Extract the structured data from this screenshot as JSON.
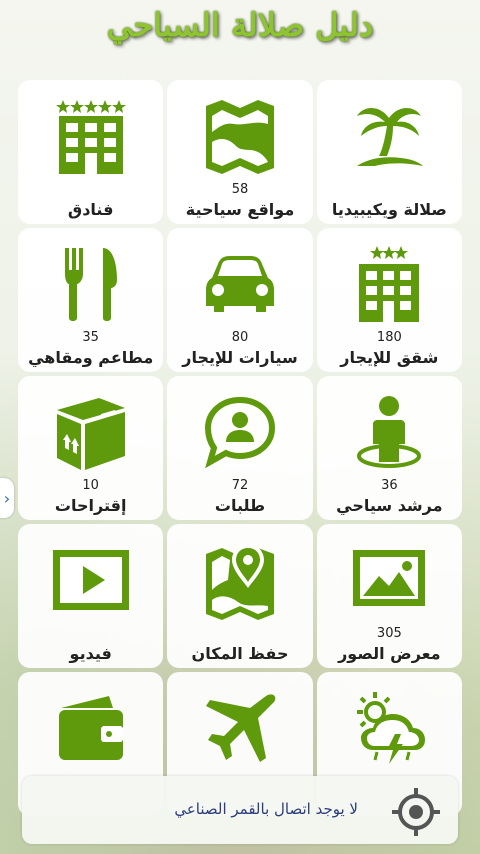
{
  "app": {
    "title": "دليل صلالة السياحي"
  },
  "tiles": [
    {
      "label": "صلالة ويكيبيديا",
      "count": "",
      "icon": "palm-tree-icon"
    },
    {
      "label": "مواقع سياحية",
      "count": "58",
      "icon": "map-icon"
    },
    {
      "label": "فنادق",
      "count": "",
      "icon": "hotel-icon"
    },
    {
      "label": "شقق للإيجار",
      "count": "180",
      "icon": "apartment-icon"
    },
    {
      "label": "سيارات للإيجار",
      "count": "80",
      "icon": "car-icon"
    },
    {
      "label": "مطاعم ومقاهي",
      "count": "35",
      "icon": "fork-knife-icon"
    },
    {
      "label": "مرشد سياحي",
      "count": "36",
      "icon": "tour-guide-icon"
    },
    {
      "label": "طلبات",
      "count": "72",
      "icon": "chat-user-icon"
    },
    {
      "label": "إقتراحات",
      "count": "10",
      "icon": "box-icon"
    },
    {
      "label": "معرض الصور",
      "count": "305",
      "icon": "image-gallery-icon"
    },
    {
      "label": "حفظ المكان",
      "count": "",
      "icon": "map-pin-icon"
    },
    {
      "label": "فيديو",
      "count": "",
      "icon": "video-icon"
    },
    {
      "label": "",
      "count": "",
      "icon": "weather-icon"
    },
    {
      "label": "",
      "count": "",
      "icon": "airplane-icon"
    },
    {
      "label": "",
      "count": "",
      "icon": "wallet-icon"
    }
  ],
  "status": {
    "message": "لا يوجد اتصال بالقمر الصناعي",
    "icon": "gps-target-icon"
  },
  "side_handle": {
    "icon": "chevron-right-icon",
    "glyph": "›"
  },
  "colors": {
    "accent": "#5f9a0c",
    "title": "#8fc431",
    "status_text": "#2c3e7a"
  }
}
